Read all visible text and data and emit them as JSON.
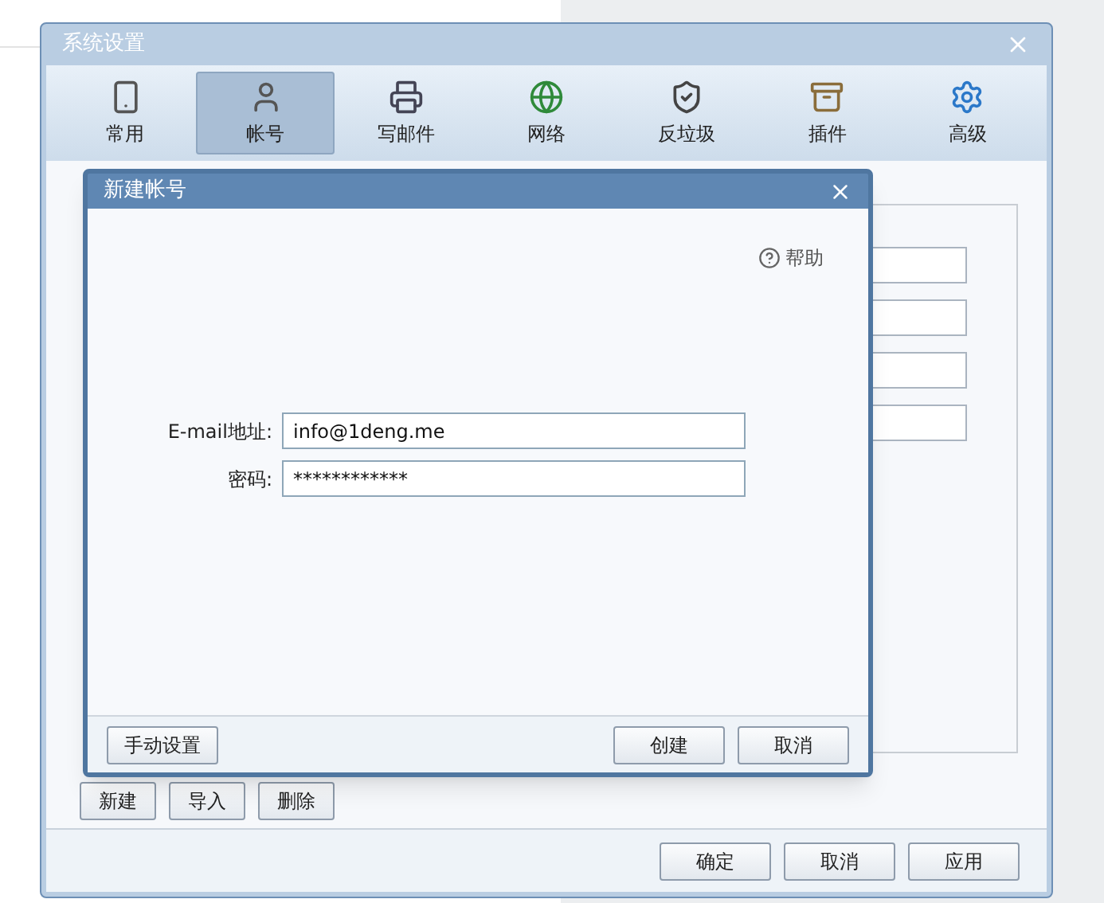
{
  "window": {
    "title": "系统设置"
  },
  "tabs": [
    {
      "label": "常用",
      "selected": false
    },
    {
      "label": "帐号",
      "selected": true
    },
    {
      "label": "写邮件",
      "selected": false
    },
    {
      "label": "网络",
      "selected": false
    },
    {
      "label": "反垃圾",
      "selected": false
    },
    {
      "label": "插件",
      "selected": false
    },
    {
      "label": "高级",
      "selected": false
    }
  ],
  "account_buttons": [
    "新建",
    "导入",
    "删除"
  ],
  "footer_buttons": [
    "确定",
    "取消",
    "应用"
  ],
  "dialog": {
    "title": "新建帐号",
    "help": "帮助",
    "fields": [
      {
        "label": "E-mail地址:",
        "value": "info@1deng.me"
      },
      {
        "label": "密码:",
        "value": "************"
      }
    ],
    "left_button": "手动设置",
    "buttons": [
      "创建",
      "取消"
    ]
  }
}
